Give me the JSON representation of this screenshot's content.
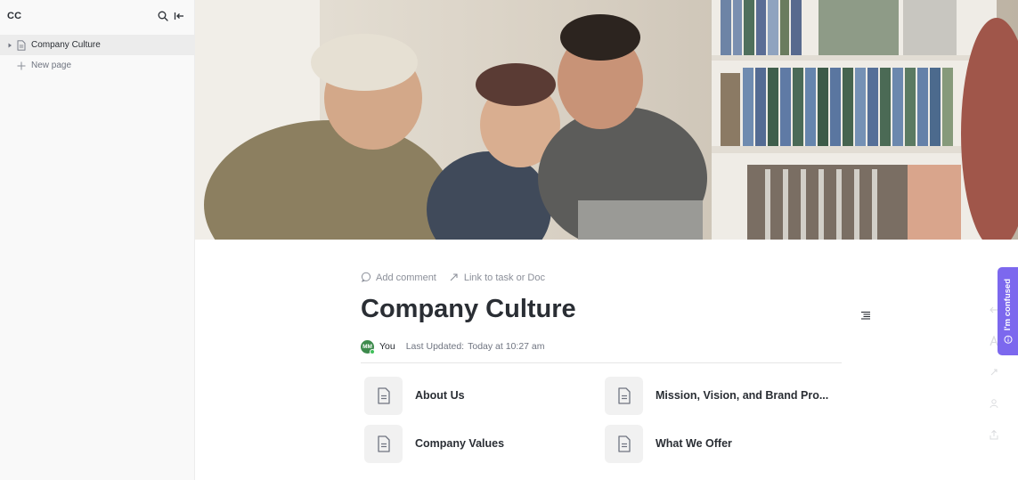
{
  "sidebar": {
    "workspace_title": "CC",
    "pages": [
      {
        "label": "Company Culture"
      }
    ],
    "new_page_label": "New page"
  },
  "cover": {
    "kind": "photo",
    "subject": "people laughing near bookshelves"
  },
  "doc": {
    "actions": {
      "add_comment": "Add comment",
      "link_task": "Link to task or Doc"
    },
    "title": "Company Culture",
    "author": {
      "initials": "MM",
      "name": "You"
    },
    "last_updated_label": "Last Updated:",
    "last_updated_value": "Today at 10:27 am",
    "subpages": [
      {
        "label": "About Us"
      },
      {
        "label": "Mission, Vision, and Brand Pro..."
      },
      {
        "label": "Company Values"
      },
      {
        "label": "What We Offer"
      }
    ]
  },
  "feedback": {
    "label": "I'm confused"
  },
  "colors": {
    "accent": "#7c68ee",
    "avatar": "#3d8a4c"
  }
}
